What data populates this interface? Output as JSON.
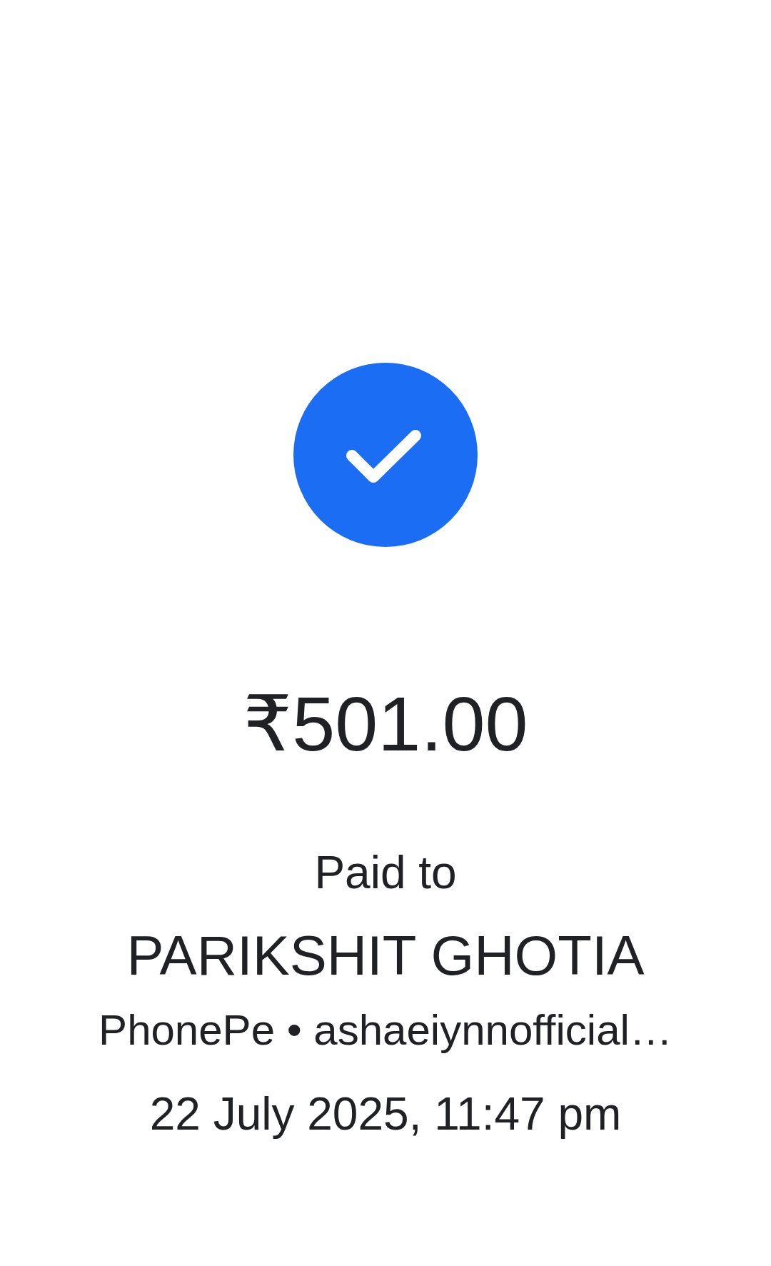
{
  "amount": "₹501.00",
  "paid_to_label": "Paid to",
  "payee_name": "PARIKSHIT GHOTIA",
  "payee_detail": "PhonePe • ashaeiynnofficial…",
  "datetime": "22 July 2025, 11:47 pm"
}
